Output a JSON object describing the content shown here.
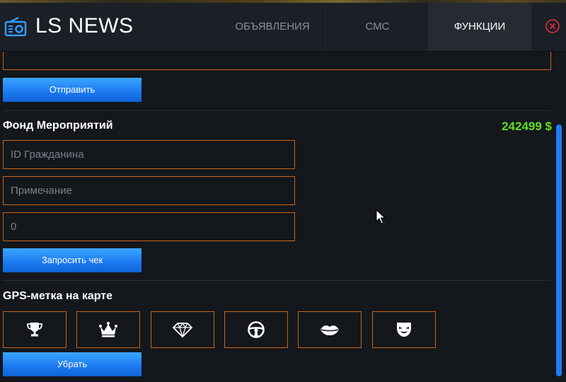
{
  "app": {
    "title": "LS NEWS",
    "logo_icon": "radio-icon"
  },
  "tabs": [
    {
      "label": "ОБЪЯВЛЕНИЯ",
      "active": false
    },
    {
      "label": "СМС",
      "active": false
    },
    {
      "label": "ФУНКЦИИ",
      "active": true
    }
  ],
  "close_icon": "close-circle-icon",
  "send_section": {
    "send_label": "Отправить"
  },
  "fund_section": {
    "title": "Фонд Мероприятий",
    "balance": "242499 $",
    "citizen_id_placeholder": "ID Гражданина",
    "note_placeholder": "Примечание",
    "amount_placeholder": "0",
    "request_check_label": "Запросить чек"
  },
  "gps_section": {
    "title": "GPS-метка на карте",
    "markers": [
      {
        "icon": "trophy-icon"
      },
      {
        "icon": "crown-icon"
      },
      {
        "icon": "diamond-icon"
      },
      {
        "icon": "steering-wheel-icon"
      },
      {
        "icon": "lips-icon"
      },
      {
        "icon": "theater-mask-icon"
      }
    ],
    "remove_label": "Убрать"
  },
  "colors": {
    "accent_blue": "#1e7cf2",
    "border_orange": "#c9651c",
    "balance_green": "#5fe01b",
    "close_red": "#e0323c",
    "background": "#14171c"
  }
}
